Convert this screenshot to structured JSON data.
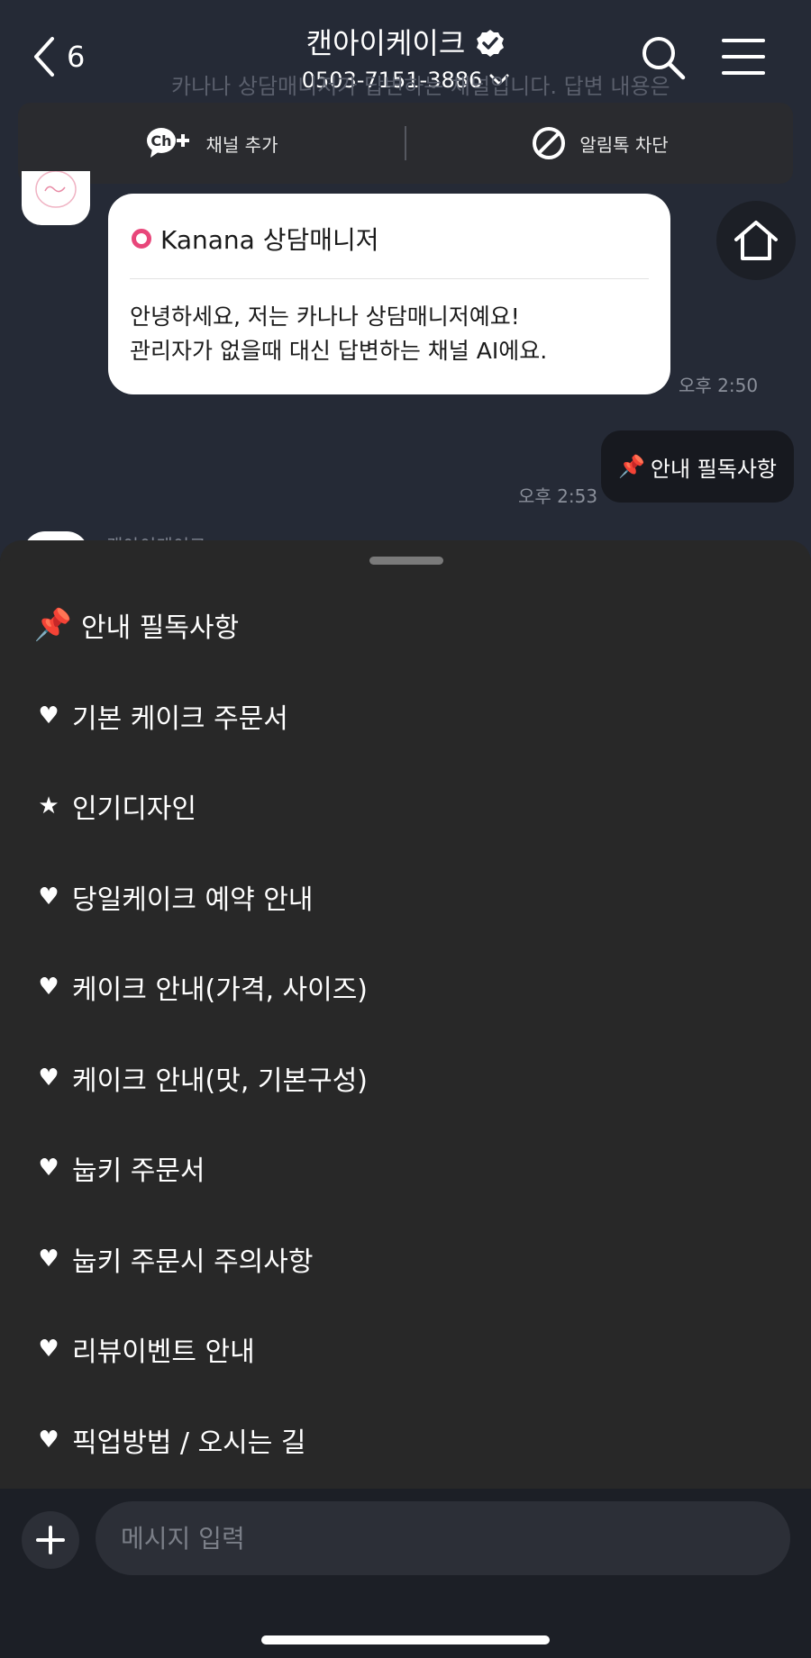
{
  "header": {
    "back_count": "6",
    "title": "캔아이케이크",
    "phone": "0503-7151-3886"
  },
  "notice": {
    "ghost_text": "카나나 상담매니저가 답변하는 채널입니다. 답변 내용은"
  },
  "actions": {
    "add_channel_label": "채널 추가",
    "block_label": "알림톡 차단"
  },
  "bot_message": {
    "sender": "Kanana 상담매니저",
    "line1": "안녕하세요, 저는 카나나 상담매니저예요!",
    "line2": "관리자가 없을때 대신 답변하는 채널 AI에요.",
    "time": "오후 2:50"
  },
  "user_message": {
    "pin_emoji": "📌",
    "text": "안내 필독사항",
    "time": "오후 2:53"
  },
  "peek_name": "캔아이케이크",
  "menu": {
    "items": [
      {
        "icon": "📌",
        "label": "안내 필독사항"
      },
      {
        "icon": "♥",
        "label": "기본 케이크 주문서"
      },
      {
        "icon": "★",
        "label": "인기디자인"
      },
      {
        "icon": "♥",
        "label": "당일케이크 예약 안내"
      },
      {
        "icon": "♥",
        "label": "케이크 안내(가격, 사이즈)"
      },
      {
        "icon": "♥",
        "label": "케이크 안내(맛, 기본구성)"
      },
      {
        "icon": "♥",
        "label": "눕키 주문서"
      },
      {
        "icon": "♥",
        "label": "눕키 주문시 주의사항"
      },
      {
        "icon": "♥",
        "label": "리뷰이벤트 안내"
      },
      {
        "icon": "♥",
        "label": "픽업방법 / 오시는 길"
      }
    ]
  },
  "input": {
    "placeholder": "메시지 입력"
  }
}
